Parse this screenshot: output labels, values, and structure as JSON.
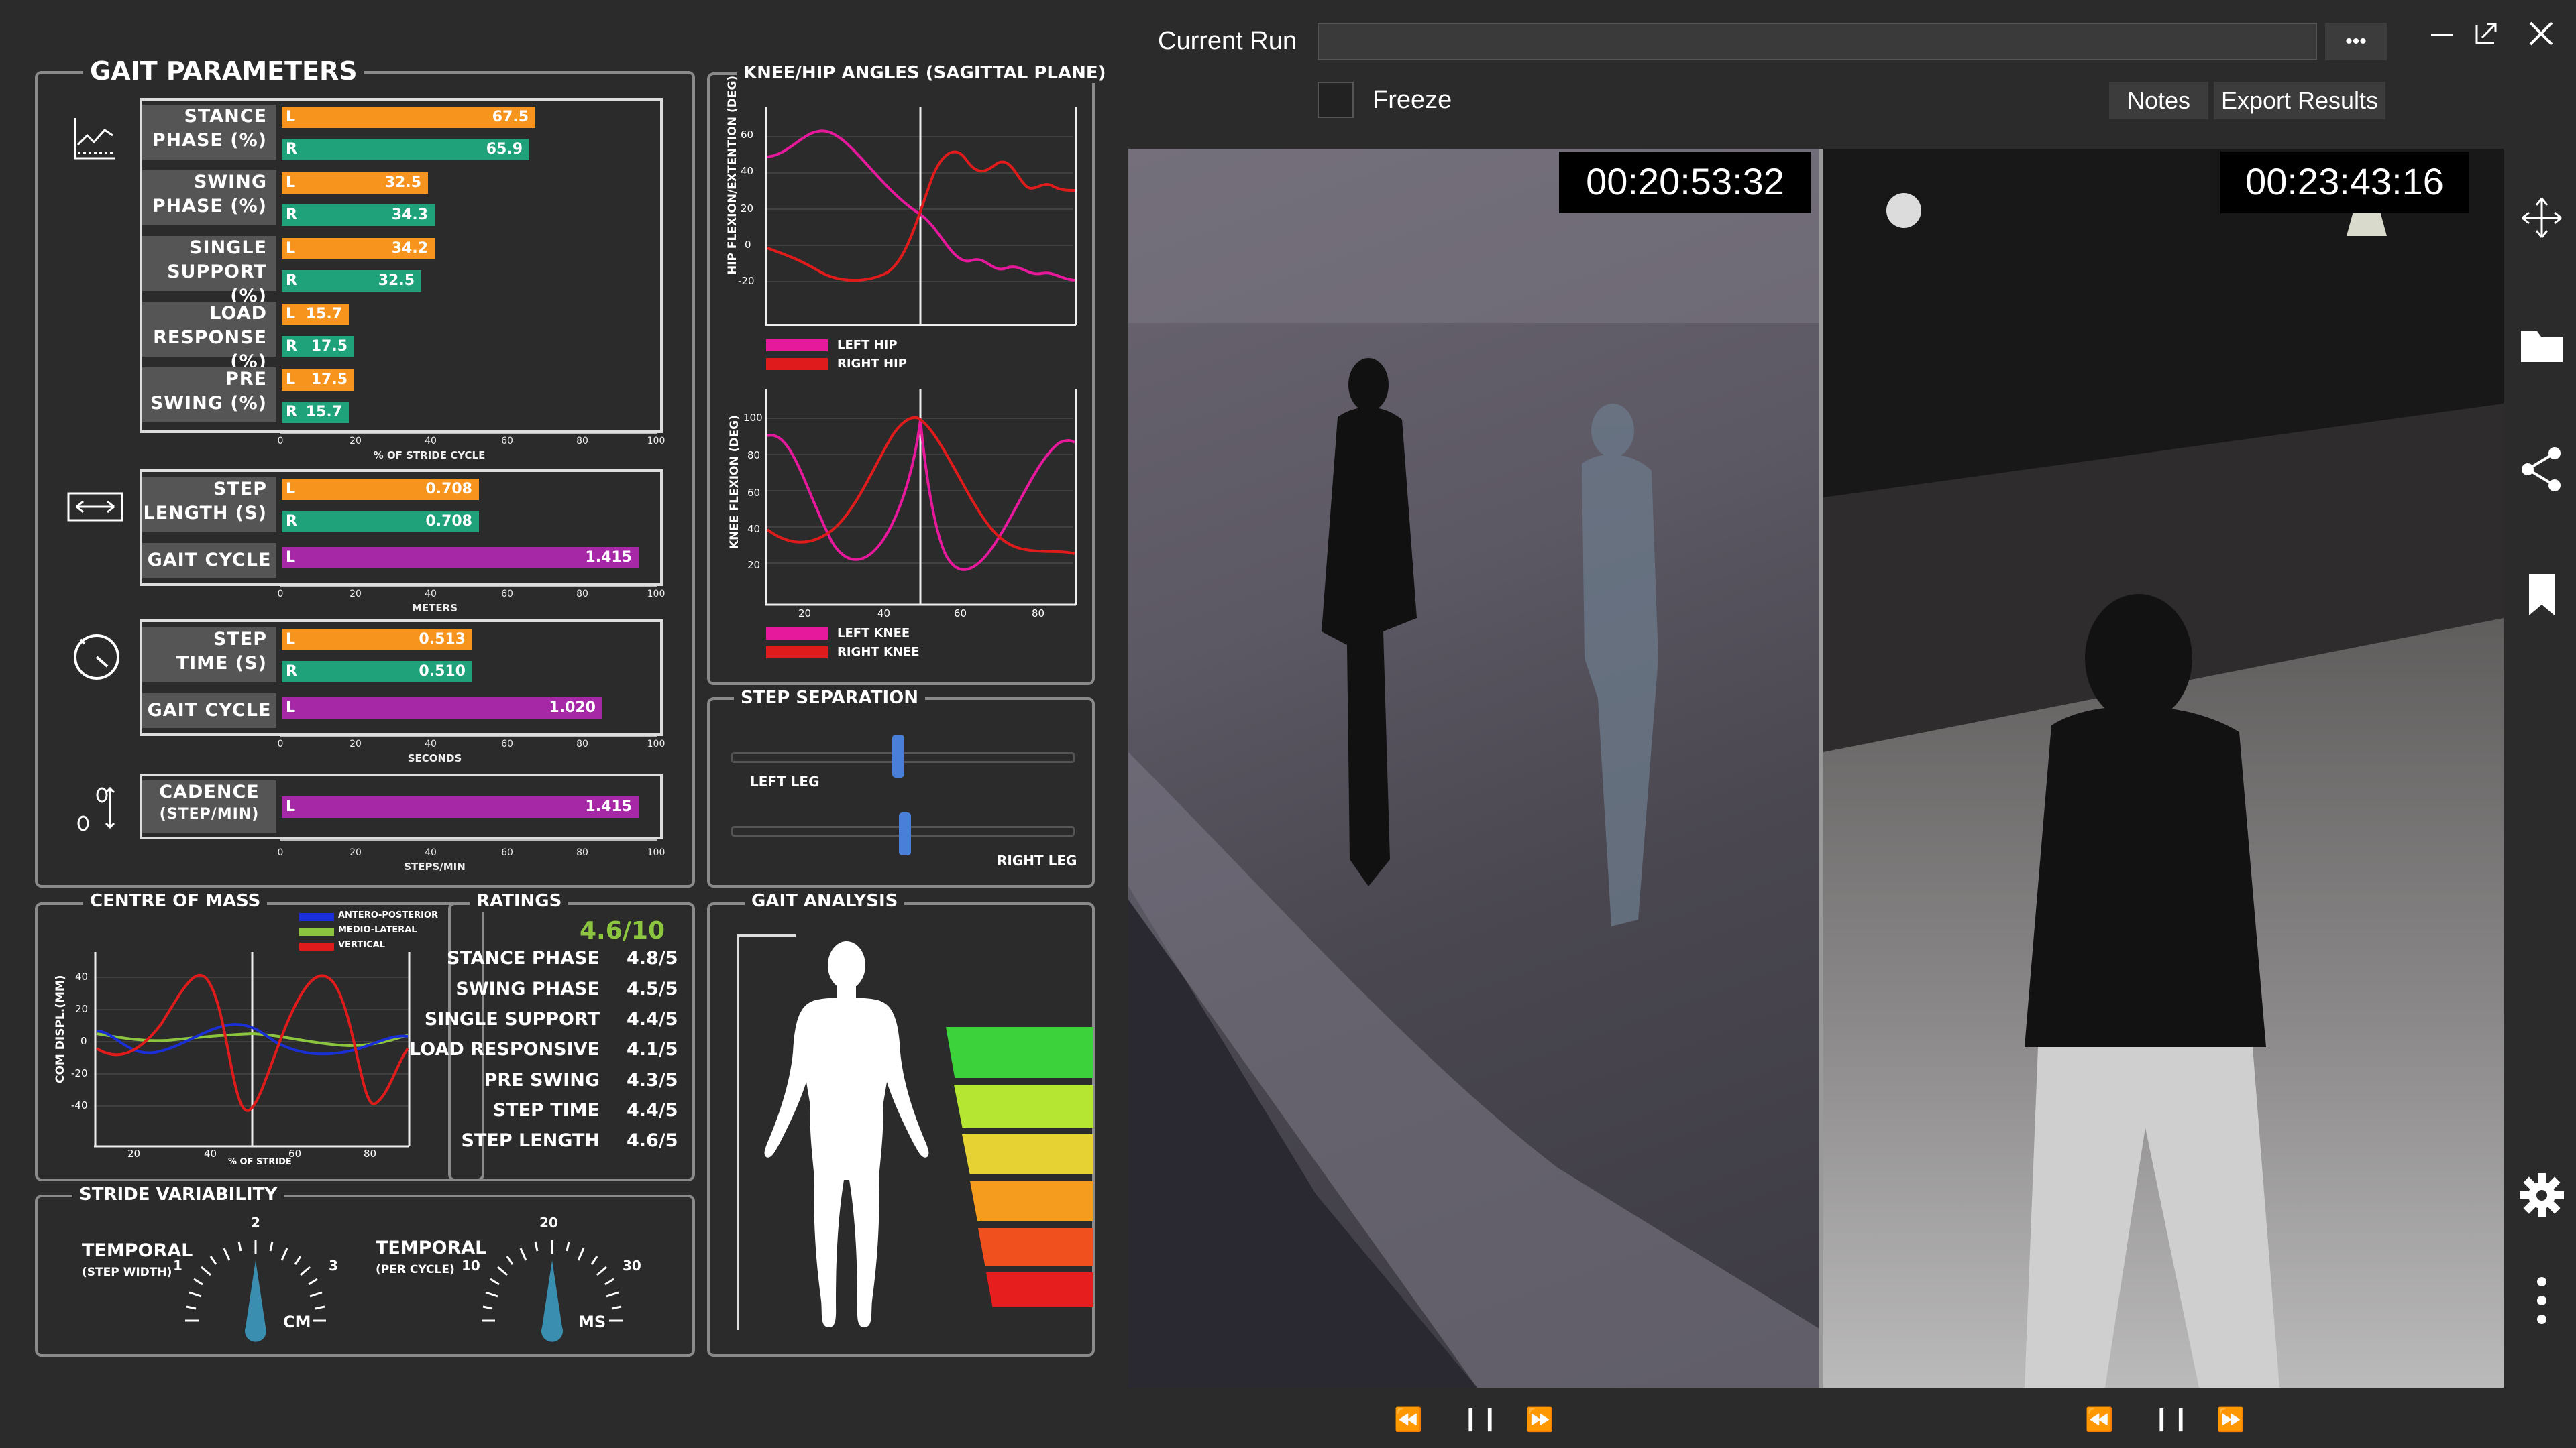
{
  "gait_parameters": {
    "title": "GAIT PARAMETERS",
    "rows": [
      {
        "label1": "STANCE",
        "label2": "PHASE (%)",
        "left": "67.5",
        "right": "65.9",
        "left_pct": 67.5,
        "right_pct": 65.9
      },
      {
        "label1": "SWING",
        "label2": "PHASE (%)",
        "left": "32.5",
        "right": "34.3",
        "left_pct": 32.5,
        "right_pct": 34.3
      },
      {
        "label1": "SINGLE",
        "label2": "SUPPORT (%)",
        "left": "34.2",
        "right": "32.5",
        "left_pct": 34.2,
        "right_pct": 32.5
      },
      {
        "label1": "LOAD",
        "label2": "RESPONSE (%)",
        "left": "15.7",
        "right": "17.5",
        "left_pct": 15.7,
        "right_pct": 17.5
      },
      {
        "label1": "PRE",
        "label2": "SWING (%)",
        "left": "17.5",
        "right": "15.7",
        "left_pct": 17.5,
        "right_pct": 15.7
      }
    ],
    "stride_axis": {
      "ticks": [
        "0",
        "20",
        "40",
        "60",
        "80",
        "100"
      ],
      "unit": "% OF STRIDE CYCLE"
    },
    "step_length": {
      "label1": "STEP",
      "label2": "LENGTH (S)",
      "left": "0.708",
      "right": "0.708",
      "left_pct": 52,
      "right_pct": 52
    },
    "gait_cycle_1": {
      "label": "GAIT CYCLE",
      "side": "L",
      "value": "1.415",
      "pct": 95
    },
    "meters_axis": {
      "ticks": [
        "0",
        "20",
        "40",
        "60",
        "80",
        "100"
      ],
      "unit": "METERS"
    },
    "step_time": {
      "label1": "STEP",
      "label2": "TIME (S)",
      "left": "0.513",
      "right": "0.510",
      "left_pct": 50,
      "right_pct": 50
    },
    "gait_cycle_2": {
      "label": "GAIT CYCLE",
      "side": "L",
      "value": "1.020",
      "pct": 88
    },
    "seconds_axis": {
      "ticks": [
        "0",
        "20",
        "40",
        "60",
        "80",
        "100"
      ],
      "unit": "SECONDS"
    },
    "cadence": {
      "label1": "CADENCE",
      "label2": "(STEP/MIN)",
      "side": "L",
      "value": "1.415",
      "pct": 95
    },
    "steps_axis": {
      "ticks": [
        "0",
        "20",
        "40",
        "60",
        "80",
        "100"
      ],
      "unit": "STEPS/MIN"
    },
    "side_left": "L",
    "side_right": "R"
  },
  "knee_hip": {
    "title": "KNEE/HIP ANGLES (SAGITTAL PLANE)",
    "hip_ylabel": "HIP FLEXION/EXTENTION (DEG)",
    "hip_yticks": [
      "60",
      "40",
      "20",
      "0",
      "-20"
    ],
    "hip_legend": [
      {
        "name": "LEFT HIP",
        "color": "#e6189b"
      },
      {
        "name": "RIGHT HIP",
        "color": "#e01b1b"
      }
    ],
    "knee_ylabel": "KNEE FLEXION (DEG)",
    "knee_yticks": [
      "100",
      "80",
      "60",
      "40",
      "20"
    ],
    "knee_xticks": [
      "20",
      "40",
      "60",
      "80"
    ],
    "knee_legend": [
      {
        "name": "LEFT KNEE",
        "color": "#e6189b"
      },
      {
        "name": "RIGHT KNEE",
        "color": "#e01b1b"
      }
    ]
  },
  "step_separation": {
    "title": "STEP SEPARATION",
    "left_leg": "LEFT LEG",
    "right_leg": "RIGHT LEG",
    "left_value": 0.49,
    "right_value": 0.51
  },
  "centre_of_mass": {
    "title": "CENTRE OF MASS",
    "legend": [
      {
        "name": "ANTERO-POSTERIOR",
        "color": "#1a2fd6"
      },
      {
        "name": "MEDIO-LATERAL",
        "color": "#8cc63f"
      },
      {
        "name": "VERTICAL",
        "color": "#e01b1b"
      }
    ],
    "ylabel": "COM DISPL.(MM)",
    "yticks": [
      "40",
      "20",
      "0",
      "-20",
      "-40"
    ],
    "xticks": [
      "20",
      "40",
      "60",
      "80"
    ],
    "xunit": "% OF STRIDE"
  },
  "ratings": {
    "title": "RATINGS",
    "overall": "4.6/10",
    "items": [
      {
        "name": "STANCE PHASE",
        "value": "4.8/5"
      },
      {
        "name": "SWING PHASE",
        "value": "4.5/5"
      },
      {
        "name": "SINGLE SUPPORT",
        "value": "4.4/5"
      },
      {
        "name": "LOAD RESPONSIVE",
        "value": "4.1/5"
      },
      {
        "name": "PRE SWING",
        "value": "4.3/5"
      },
      {
        "name": "STEP TIME",
        "value": "4.4/5"
      },
      {
        "name": "STEP LENGTH",
        "value": "4.6/5"
      }
    ]
  },
  "stride_variability": {
    "title": "STRIDE VARIABILITY",
    "gauge1": {
      "title": "TEMPORAL",
      "sub": "(STEP WIDTH)",
      "min": "1",
      "mid": "2",
      "max": "3",
      "unit": "CM"
    },
    "gauge2": {
      "title": "TEMPORAL",
      "sub": "(PER CYCLE)",
      "min": "10",
      "mid": "20",
      "max": "30",
      "unit": "MS"
    }
  },
  "gait_analysis": {
    "title": "GAIT ANALYSIS",
    "scale_colors": [
      "#3cd23c",
      "#b4e632",
      "#e6e632",
      "#f59b1e",
      "#f0501e",
      "#e61e1e"
    ]
  },
  "header": {
    "current_run_label": "Current Run",
    "current_run_value": "",
    "more_label": "•••",
    "freeze_label": "Freeze",
    "notes_label": "Notes",
    "export_label": "Export Results"
  },
  "video": {
    "left_timestamp": "00:20:53:32",
    "right_timestamp": "00:23:43:16"
  }
}
